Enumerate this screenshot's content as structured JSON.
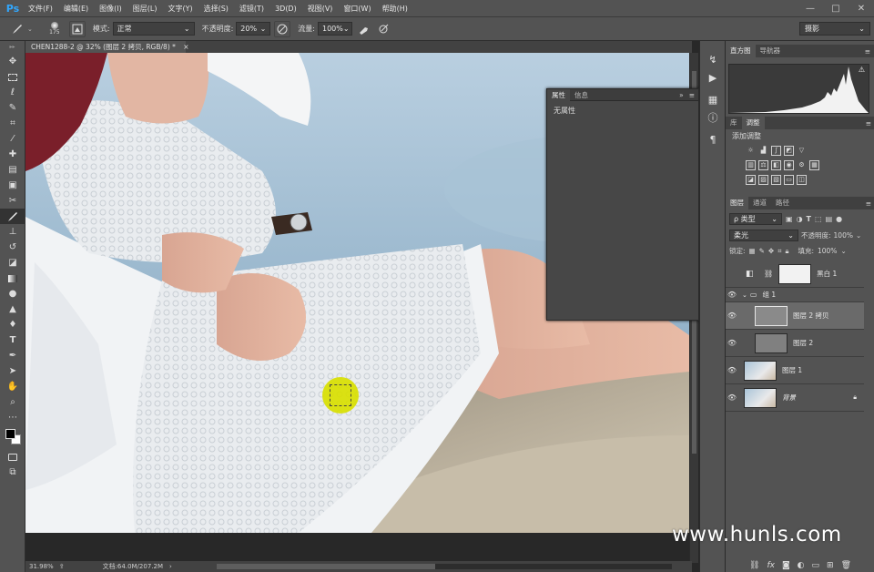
{
  "app": {
    "logo": "Ps"
  },
  "menu": [
    "文件(F)",
    "编辑(E)",
    "图像(I)",
    "图层(L)",
    "文字(Y)",
    "选择(S)",
    "滤镜(T)",
    "3D(D)",
    "视图(V)",
    "窗口(W)",
    "帮助(H)"
  ],
  "window_controls": [
    "—",
    "□",
    "✕"
  ],
  "options": {
    "brush_size": "175",
    "mode_label": "模式:",
    "mode_value": "正常",
    "opacity_label": "不透明度:",
    "opacity_value": "20%",
    "flow_label": "流量:",
    "flow_value": "100%",
    "workspace": "摄影"
  },
  "document": {
    "tab_title": "CHEN1288-2 @ 32% (图层 2 拷贝, RGB/8) *",
    "close": "×"
  },
  "status": {
    "zoom": "31.98%",
    "doc_size": "文档:64.0M/207.2M"
  },
  "properties_panel": {
    "tabs": [
      "属性",
      "信息"
    ],
    "content": "无属性"
  },
  "histogram_panel": {
    "tabs": [
      "直方图",
      "导航器"
    ]
  },
  "adjustments_panel": {
    "tabs": [
      "库",
      "调整"
    ],
    "label": "添加调整"
  },
  "layers_panel": {
    "tabs": [
      "图层",
      "通道",
      "路径"
    ],
    "filter_type": "ρ 类型",
    "blend_mode": "柔光",
    "opacity_label": "不透明度:",
    "opacity_value": "100%",
    "lock_label": "锁定:",
    "fill_label": "填充:",
    "fill_value": "100%",
    "layers": [
      {
        "name": "黑白 1"
      },
      {
        "name": "组 1"
      },
      {
        "name": "图层 2 拷贝"
      },
      {
        "name": "图层 2"
      },
      {
        "name": "图层 1"
      },
      {
        "name": "背景"
      }
    ],
    "footer_icons": [
      "link-icon",
      "fx-icon",
      "mask-icon",
      "adjustment-icon",
      "folder-icon",
      "new-layer-icon",
      "trash-icon"
    ]
  },
  "watermark": "www.hunls.com"
}
